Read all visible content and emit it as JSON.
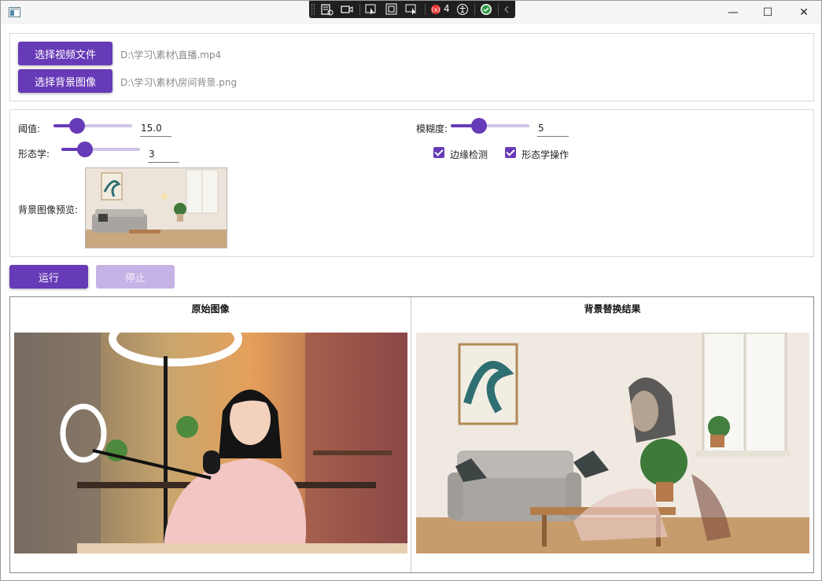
{
  "window": {
    "debug_toolbar": {
      "frame_count": "4"
    },
    "controls": {
      "minimize": "—",
      "maximize": "☐",
      "close": "✕"
    }
  },
  "files": {
    "video_button": "选择视频文件",
    "video_path": "D:\\学习\\素材\\直播.mp4",
    "background_button": "选择背景图像",
    "background_path": "D:\\学习\\素材\\房间背景.png"
  },
  "params": {
    "threshold_label": "阈值:",
    "threshold_value": "15.0",
    "threshold_level": 0.3,
    "morph_label": "形态学:",
    "morph_value": "3",
    "morph_level": 0.3,
    "blur_label": "模糊度:",
    "blur_value": "5",
    "blur_level": 0.36,
    "edge_detect_label": "边缘检测",
    "edge_detect_checked": true,
    "morph_op_label": "形态学操作",
    "morph_op_checked": true,
    "preview_label": "背景图像预览:"
  },
  "actions": {
    "run": "运行",
    "stop": "停止"
  },
  "panels": {
    "original_title": "原始图像",
    "result_title": "背景替换结果"
  },
  "colors": {
    "accent": "#673ab7",
    "accent_light": "#d1c4e9",
    "accent_disabled": "#c5b3e6"
  }
}
